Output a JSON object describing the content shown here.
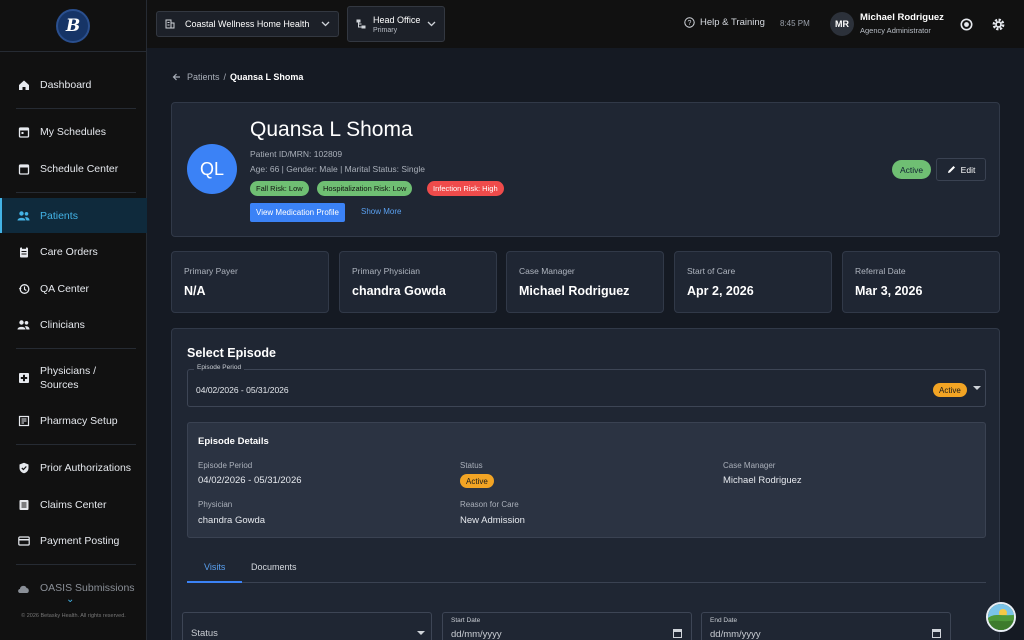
{
  "app": {
    "logo_text": "B",
    "copyright": "© 2026 Betasky Health. All rights reserved."
  },
  "sidebar": {
    "items": [
      {
        "label": "Dashboard",
        "icon": "home-icon"
      },
      {
        "label": "My Schedules",
        "icon": "calendar-icon"
      },
      {
        "label": "Schedule Center",
        "icon": "calendar-icon"
      },
      {
        "label": "Patients",
        "icon": "people-icon",
        "active": true
      },
      {
        "label": "Care Orders",
        "icon": "clipboard-icon"
      },
      {
        "label": "QA Center",
        "icon": "history-icon"
      },
      {
        "label": "Clinicians",
        "icon": "people-icon"
      },
      {
        "label": "Physicians / Sources",
        "icon": "medical-plus-icon"
      },
      {
        "label": "Pharmacy Setup",
        "icon": "pharmacy-icon"
      },
      {
        "label": "Prior Authorizations",
        "icon": "shield-check-icon"
      },
      {
        "label": "Claims Center",
        "icon": "list-icon"
      },
      {
        "label": "Payment Posting",
        "icon": "credit-card-icon"
      },
      {
        "label": "OASIS Submissions",
        "icon": "cloud-upload-icon"
      }
    ]
  },
  "topbar": {
    "agency": "Coastal Wellness Home Health",
    "office": "Head Office",
    "office_sub": "Primary",
    "help": "Help & Training",
    "time": "8:45 PM",
    "user_initials": "MR",
    "user_name": "Michael Rodriguez",
    "user_role": "Agency Administrator"
  },
  "breadcrumb": {
    "parent": "Patients",
    "separator": "/",
    "current": "Quansa L Shoma"
  },
  "patient": {
    "initials": "QL",
    "name": "Quansa L Shoma",
    "id_line": "Patient ID/MRN: 102809",
    "demo_line": "Age: 66 | Gender: Male | Marital Status: Single",
    "risks": [
      {
        "label": "Fall Risk: Low",
        "color": "#6fbf73"
      },
      {
        "label": "Hospitalization Risk: Low",
        "color": "#6fbf73"
      },
      {
        "label": "Infection Risk: High",
        "color": "#ef4b4b"
      }
    ],
    "med_button": "View Medication Profile",
    "show_more": "Show More",
    "status": "Active",
    "edit": "Edit"
  },
  "stats": [
    {
      "label": "Primary Payer",
      "value": "N/A"
    },
    {
      "label": "Primary Physician",
      "value": "chandra Gowda"
    },
    {
      "label": "Case Manager",
      "value": "Michael Rodriguez"
    },
    {
      "label": "Start of Care",
      "value": "Apr 2, 2026"
    },
    {
      "label": "Referral Date",
      "value": "Mar 3, 2026"
    }
  ],
  "episode": {
    "title": "Select Episode",
    "field_label": "Episode Period",
    "value": "04/02/2026 - 05/31/2026",
    "badge": "Active",
    "details_title": "Episode Details",
    "period_label": "Episode Period",
    "period_value": "04/02/2026 - 05/31/2026",
    "status_label": "Status",
    "status_value": "Active",
    "cm_label": "Case Manager",
    "cm_value": "Michael Rodriguez",
    "phys_label": "Physician",
    "phys_value": "chandra Gowda",
    "reason_label": "Reason for Care",
    "reason_value": "New Admission"
  },
  "tabs": [
    {
      "label": "Visits",
      "active": true
    },
    {
      "label": "Documents"
    }
  ],
  "filters": {
    "status_placeholder": "Status",
    "start_label": "Start Date",
    "start_placeholder": "dd/mm/yyyy",
    "end_label": "End Date",
    "end_placeholder": "dd/mm/yyyy"
  },
  "colors": {
    "accent": "#43b3e6",
    "primary": "#3b82f6",
    "active_green": "#6fbf73",
    "active_orange": "#f2a424"
  }
}
